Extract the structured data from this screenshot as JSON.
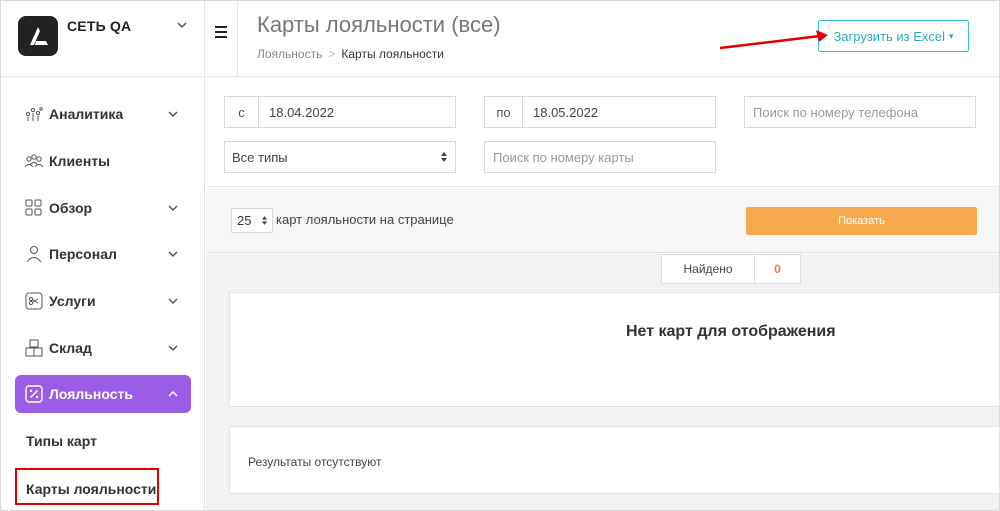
{
  "brand": {
    "name": "СЕТЬ QA"
  },
  "sidebar": {
    "items": [
      {
        "label": "Аналитика",
        "icon": "analytics-icon",
        "has_chevron": true
      },
      {
        "label": "Клиенты",
        "icon": "clients-icon",
        "has_chevron": false
      },
      {
        "label": "Обзор",
        "icon": "overview-icon",
        "has_chevron": true
      },
      {
        "label": "Персонал",
        "icon": "staff-icon",
        "has_chevron": true
      },
      {
        "label": "Услуги",
        "icon": "services-icon",
        "has_chevron": true
      },
      {
        "label": "Склад",
        "icon": "warehouse-icon",
        "has_chevron": true
      },
      {
        "label": "Лояльность",
        "icon": "loyalty-icon",
        "has_chevron": true,
        "active": true
      }
    ],
    "subitems": [
      {
        "label": "Типы карт"
      },
      {
        "label": "Карты лояльности",
        "highlighted": true
      }
    ]
  },
  "header": {
    "title": "Карты лояльности (все)",
    "breadcrumb": {
      "parent": "Лояльность",
      "separator": ">",
      "current": "Карты лояльности"
    },
    "excel_button": "Загрузить из Excel"
  },
  "filters": {
    "date_from": {
      "prefix": "с",
      "value": "18.04.2022"
    },
    "date_to": {
      "prefix": "по",
      "value": "18.05.2022"
    },
    "phone_search": {
      "placeholder": "Поиск по номеру телефона"
    },
    "type_select": {
      "value": "Все типы"
    },
    "card_search": {
      "placeholder": "Поиск по номеру карты"
    }
  },
  "pager": {
    "per_page": "25",
    "per_page_label": "карт лояльности на странице",
    "show_button": "Показать"
  },
  "results": {
    "found_label": "Найдено",
    "found_count": "0",
    "empty_message": "Нет карт для отображения",
    "no_results": "Результаты отсутствуют"
  },
  "colors": {
    "accent_purple": "#9b5de5",
    "excel_border": "#3cc1d1",
    "show_button": "#f7a94d",
    "found_count": "#f07a3c",
    "annotation_red": "#e00000"
  }
}
